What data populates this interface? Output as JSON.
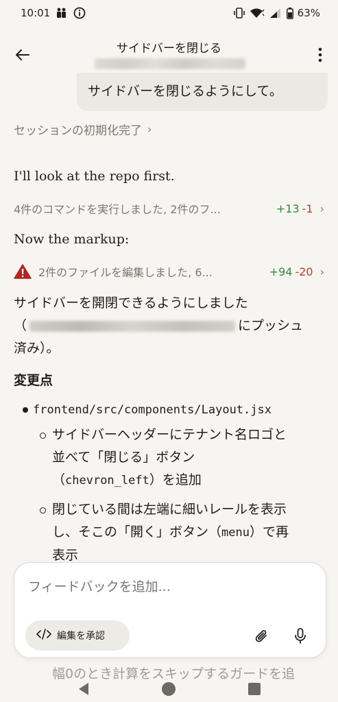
{
  "status": {
    "time": "10:01",
    "battery": "63%"
  },
  "header": {
    "title": "サイドバーを閉じる"
  },
  "user_message": "サイドバーを閉じるようにして。",
  "session": {
    "label": "セッションの初期化完了",
    "chevron": "›"
  },
  "assistant": {
    "intro": "I'll look at the repo first.",
    "tool1": {
      "text": "4件のコマンドを実行しました, 2件のフ...",
      "added": "+13",
      "removed": "-1"
    },
    "markup_text": "Now the markup:",
    "tool2": {
      "text": "2件のファイルを編集しました, 6...",
      "added": "+94",
      "removed": "-20"
    },
    "summary_line1": "サイドバーを開閉できるようにしました",
    "summary_open_paren": "（",
    "summary_line2_tail": "にプッシュ",
    "summary_line3": "済み）。",
    "heading": "変更点",
    "file_path": "frontend/src/components/Layout.jsx",
    "sub1_line1": "サイドバーヘッダーにテナント名ロゴと",
    "sub1_line2": "並べて「閉じる」ボタン",
    "sub1_code": "chevron_left",
    "sub1_line3_pre": "（",
    "sub1_line3_post": "）を追加",
    "sub2_line1": "閉じている間は左端に細いレールを表示",
    "sub2_line2_pre": "し、そこの「開く」ボタン（",
    "sub2_code": "menu",
    "sub2_line2_post": "）で再",
    "sub2_line3": "表示",
    "behind_line1": "幅0のとき計算をスキップするガードを追"
  },
  "composer": {
    "placeholder": "フィードバックを追加...",
    "approve_label": "編集を承認",
    "approve_icon": "code-icon"
  }
}
